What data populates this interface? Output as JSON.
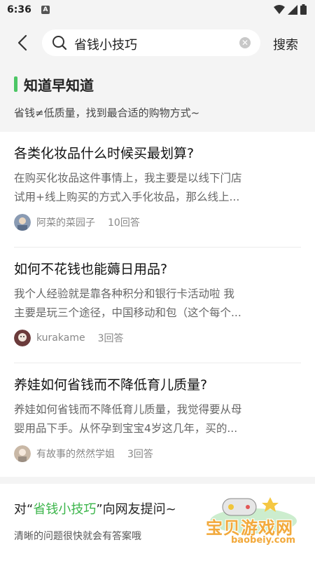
{
  "status_bar": {
    "time": "6:36",
    "a_icon_label": "A"
  },
  "search": {
    "query": "省钱小技巧",
    "button_label": "搜索"
  },
  "topic": {
    "title": "知道早知道",
    "subtitle": "省钱≠低质量，找到最合适的购物方式~"
  },
  "questions": [
    {
      "question": "各类化妆品什么时候买最划算?",
      "answer_line1": "在购买化妆品这件事情上，我主要是以线下门店",
      "answer_line2": "试用+线上购买的方式入手化妆品，那么线上...",
      "author": "阿菜的菜园子",
      "answer_count": "10回答",
      "avatar_color": "#8a9bb3"
    },
    {
      "question": "如何不花钱也能薅日用品?",
      "answer_line1": "我个人经验就是靠各种积分和银行卡活动啦 我",
      "answer_line2": "主要是玩三个途径，中国移动和包（这个每个...",
      "author": "kurakame",
      "answer_count": "3回答",
      "avatar_color": "#6b3b3b"
    },
    {
      "question": "养娃如何省钱而不降低育儿质量?",
      "answer_line1": "养娃如何省钱而不降低育儿质量，我觉得要从母",
      "answer_line2": "婴用品下手。从怀孕到宝宝4岁这几年，买的...",
      "author": "有故事的然然学姐",
      "answer_count": "3回答",
      "avatar_color": "#c9b8a6"
    }
  ],
  "ask": {
    "prefix": "对“",
    "highlight": "省钱小技巧",
    "suffix": "”向网友提问~",
    "subtitle": "清晰的问题很快就会有答案哦"
  },
  "watermark": {
    "text": "宝贝游戏网",
    "url": "baobeiy.com"
  },
  "colors": {
    "accent": "#4cc665",
    "highlight": "#3bb54a"
  }
}
